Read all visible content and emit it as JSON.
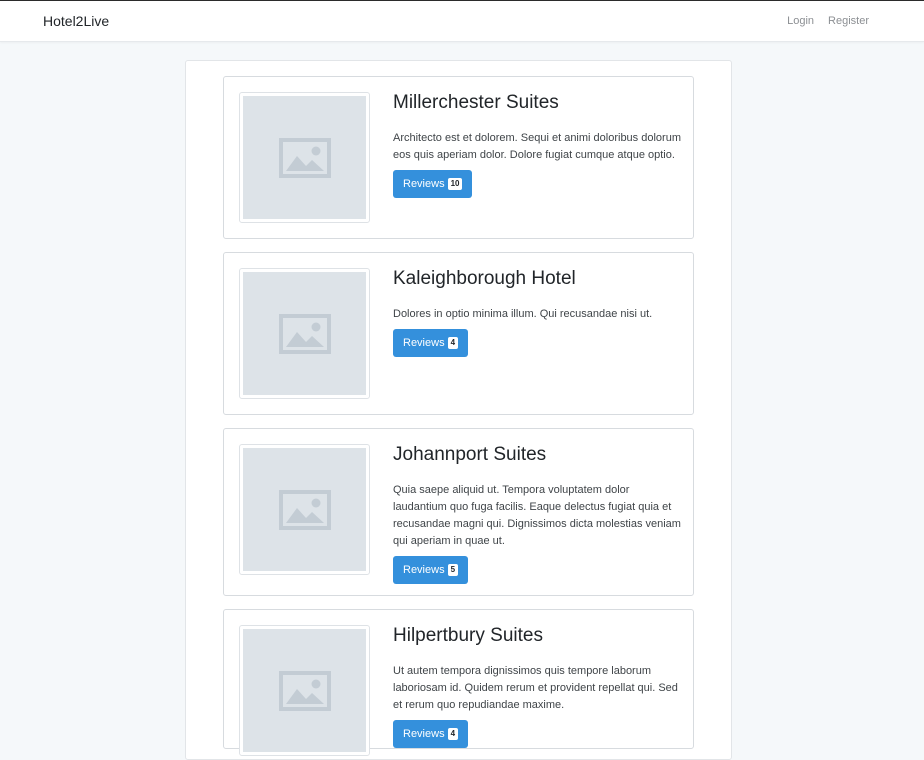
{
  "navbar": {
    "brand": "Hotel2Live",
    "login": "Login",
    "register": "Register"
  },
  "hotels": [
    {
      "name": "Millerchester Suites",
      "description": "Architecto est et dolorem. Sequi et animi doloribus dolorum eos quis aperiam dolor. Dolore fugiat cumque atque optio.",
      "reviews_label": "Reviews",
      "reviews_count": "10"
    },
    {
      "name": "Kaleighborough Hotel",
      "description": "Dolores in optio minima illum. Qui recusandae nisi ut.",
      "reviews_label": "Reviews",
      "reviews_count": "4"
    },
    {
      "name": "Johannport Suites",
      "description": "Quia saepe aliquid ut. Tempora voluptatem dolor laudantium quo fuga facilis. Eaque delectus fugiat quia et recusandae magni qui. Dignissimos dicta molestias veniam qui aperiam in quae ut.",
      "reviews_label": "Reviews",
      "reviews_count": "5"
    },
    {
      "name": "Hilpertbury Suites",
      "description": "Ut autem tempora dignissimos quis tempore laborum laboriosam id. Quidem rerum et provident repellat qui. Sed et rerum quo repudiandae maxime.",
      "reviews_label": "Reviews",
      "reviews_count": "4"
    }
  ],
  "icons": {
    "thumbnail": "image-placeholder-icon"
  },
  "colors": {
    "primary": "#3490dc",
    "background": "#f5f8fa",
    "placeholder": "#dde3e8",
    "placeholder_icon": "#c3ccd4"
  }
}
